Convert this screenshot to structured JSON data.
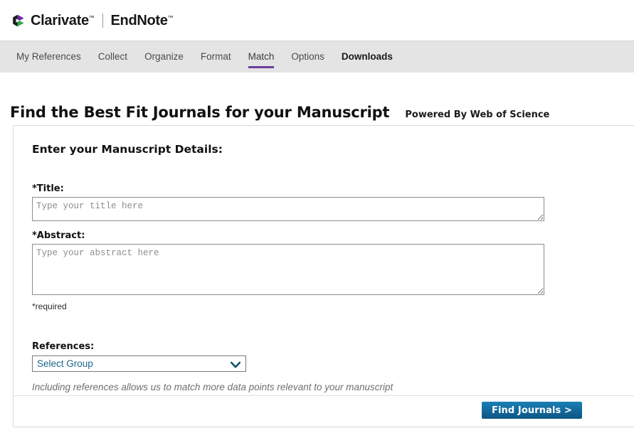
{
  "brand": {
    "company": "Clarivate",
    "product": "EndNote",
    "trademark": "™",
    "mark_colors": {
      "dark": "#1c1c1c",
      "purple": "#6d28a8",
      "green": "#2faa4b"
    }
  },
  "nav": {
    "items": [
      {
        "label": "My References",
        "active": false,
        "strong": false
      },
      {
        "label": "Collect",
        "active": false,
        "strong": false
      },
      {
        "label": "Organize",
        "active": false,
        "strong": false
      },
      {
        "label": "Format",
        "active": false,
        "strong": false
      },
      {
        "label": "Match",
        "active": true,
        "strong": false
      },
      {
        "label": "Options",
        "active": false,
        "strong": false
      },
      {
        "label": "Downloads",
        "active": false,
        "strong": true
      }
    ],
    "active_underline_color": "#6b3fa0",
    "background_color": "#e4e4e4"
  },
  "page": {
    "title": "Find the Best Fit Journals for your Manuscript",
    "subtitle": "Powered By Web of Science"
  },
  "form": {
    "heading": "Enter your Manuscript Details:",
    "title_field": {
      "label": "*Title:",
      "value": "",
      "placeholder": "Type your title here"
    },
    "abstract_field": {
      "label": "*Abstract:",
      "value": "",
      "placeholder": "Type your abstract here"
    },
    "required_note": "*required",
    "references": {
      "label": "References:",
      "selected": "Select Group",
      "options": [
        "Select Group"
      ],
      "hint": "Including references allows us to match more data points relevant to your manuscript",
      "text_color": "#1b6a8c"
    }
  },
  "footer": {
    "submit_label": "Find Journals >",
    "submit_color": "#13679a"
  }
}
